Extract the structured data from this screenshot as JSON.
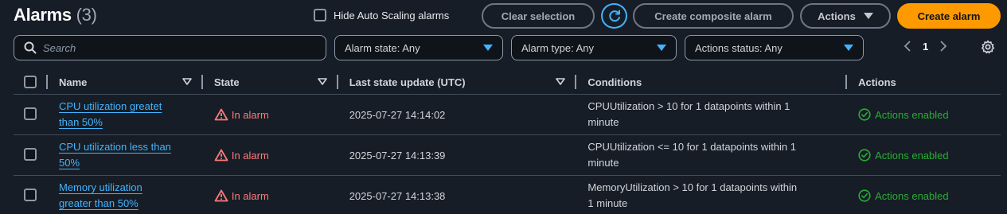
{
  "header": {
    "title": "Alarms",
    "count": "(3)",
    "hide_autoscaling_label": "Hide Auto Scaling alarms",
    "clear_selection": "Clear selection",
    "create_composite": "Create composite alarm",
    "actions": "Actions",
    "create_alarm": "Create alarm"
  },
  "filters": {
    "search_placeholder": "Search",
    "alarm_state": "Alarm state: Any",
    "alarm_type": "Alarm type: Any",
    "actions_status": "Actions status: Any"
  },
  "pagination": {
    "page": "1"
  },
  "table": {
    "columns": [
      "Name",
      "State",
      "Last state update (UTC)",
      "Conditions",
      "Actions"
    ],
    "rows": [
      {
        "name_line1": "CPU utilization greatet",
        "name_line2": "than 50%",
        "state": "In alarm",
        "updated": "2025-07-27 14:14:02",
        "cond_line1": "CPUUtilization > 10 for 1 datapoints within 1",
        "cond_line2": "minute",
        "actions": "Actions enabled"
      },
      {
        "name_line1": "CPU utilization less than",
        "name_line2": "50%",
        "state": "In alarm",
        "updated": "2025-07-27 14:13:39",
        "cond_line1": "CPUUtilization <= 10 for 1 datapoints within 1",
        "cond_line2": "minute",
        "actions": "Actions enabled"
      },
      {
        "name_line1": "Memory utilization",
        "name_line2": "greater than 50%",
        "state": "In alarm",
        "updated": "2025-07-27 14:13:38",
        "cond_line1": "MemoryUtilization > 10 for 1 datapoints within",
        "cond_line2": "1 minute",
        "actions": "Actions enabled"
      }
    ]
  },
  "colors": {
    "background": "#161d26",
    "accent": "#42b4ff",
    "primary_button": "#ff9900",
    "alarm_red": "#ff7a7a",
    "enabled_green": "#29ad32"
  },
  "icons": [
    "refresh-icon",
    "caret-down-icon",
    "search-icon",
    "chevron-left-icon",
    "chevron-right-icon",
    "gear-icon",
    "warning-icon",
    "check-circle-icon"
  ]
}
